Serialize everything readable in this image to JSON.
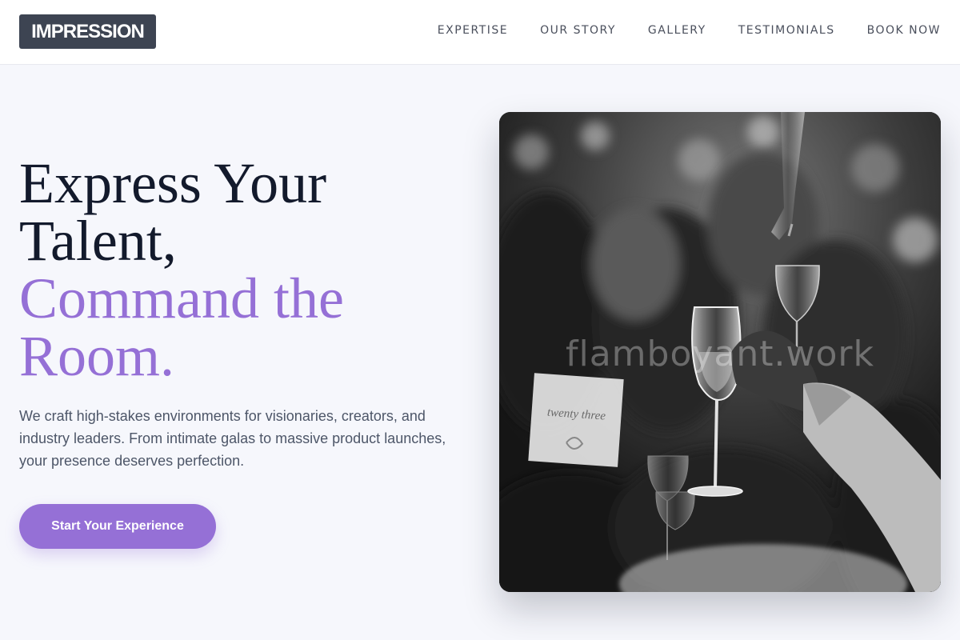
{
  "header": {
    "logo_text": "IMPRESSION",
    "nav": [
      {
        "label": "EXPERTISE"
      },
      {
        "label": "OUR STORY"
      },
      {
        "label": "GALLERY"
      },
      {
        "label": "TESTIMONIALS"
      },
      {
        "label": "BOOK NOW"
      }
    ]
  },
  "hero": {
    "headline_line1": "Express Your",
    "headline_line2": "Talent,",
    "headline_accent_line1": "Command the",
    "headline_accent_line2": "Room.",
    "description": "We craft high-stakes environments for visionaries, creators, and industry leaders. From intimate galas to massive product launches, your presence deserves perfection.",
    "cta_label": "Start Your Experience",
    "image_watermark": "flamboyant.work",
    "place_card_text": "twenty three"
  },
  "colors": {
    "accent": "#9570d6",
    "logo_bg": "#3d4452",
    "page_bg": "#f6f7fc",
    "headline": "#131a2c"
  },
  "icons": {
    "photo": "event-toast-photo"
  }
}
